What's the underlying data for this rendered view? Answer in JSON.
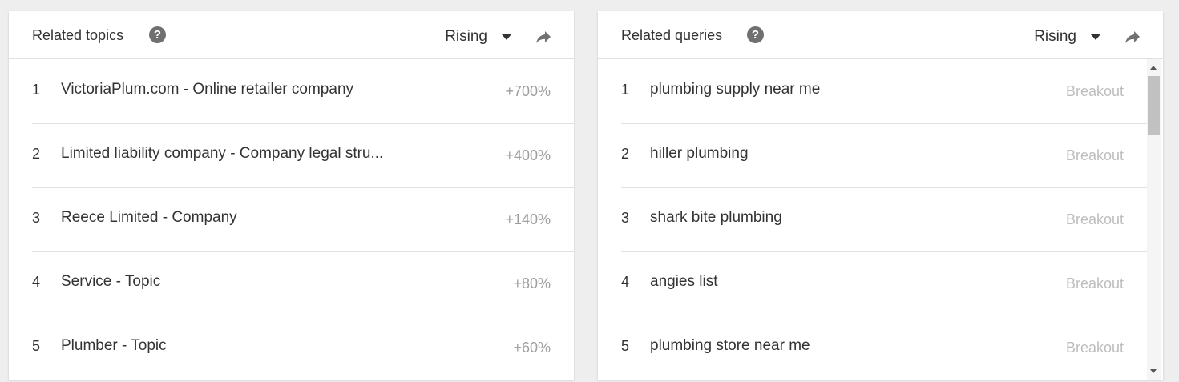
{
  "related_topics": {
    "title": "Related topics",
    "help_icon": "help-circle-icon",
    "filter": "Rising",
    "share_icon": "share-arrow-icon",
    "rows": [
      {
        "rank": "1",
        "label": "VictoriaPlum.com - Online retailer company",
        "value": "+700%"
      },
      {
        "rank": "2",
        "label": "Limited liability company - Company legal stru...",
        "value": "+400%"
      },
      {
        "rank": "3",
        "label": "Reece Limited - Company",
        "value": "+140%"
      },
      {
        "rank": "4",
        "label": "Service - Topic",
        "value": "+80%"
      },
      {
        "rank": "5",
        "label": "Plumber - Topic",
        "value": "+60%"
      }
    ]
  },
  "related_queries": {
    "title": "Related queries",
    "help_icon": "help-circle-icon",
    "filter": "Rising",
    "share_icon": "share-arrow-icon",
    "rows": [
      {
        "rank": "1",
        "label": "plumbing supply near me",
        "value": "Breakout"
      },
      {
        "rank": "2",
        "label": "hiller plumbing",
        "value": "Breakout"
      },
      {
        "rank": "3",
        "label": "shark bite plumbing",
        "value": "Breakout"
      },
      {
        "rank": "4",
        "label": "angies list",
        "value": "Breakout"
      },
      {
        "rank": "5",
        "label": "plumbing store near me",
        "value": "Breakout"
      }
    ]
  },
  "colors": {
    "background": "#eeeeee",
    "card": "#ffffff",
    "text": "#333333",
    "muted_value": "#9e9e9e",
    "breakout_value": "#bdbdbd",
    "icon": "#707070"
  }
}
